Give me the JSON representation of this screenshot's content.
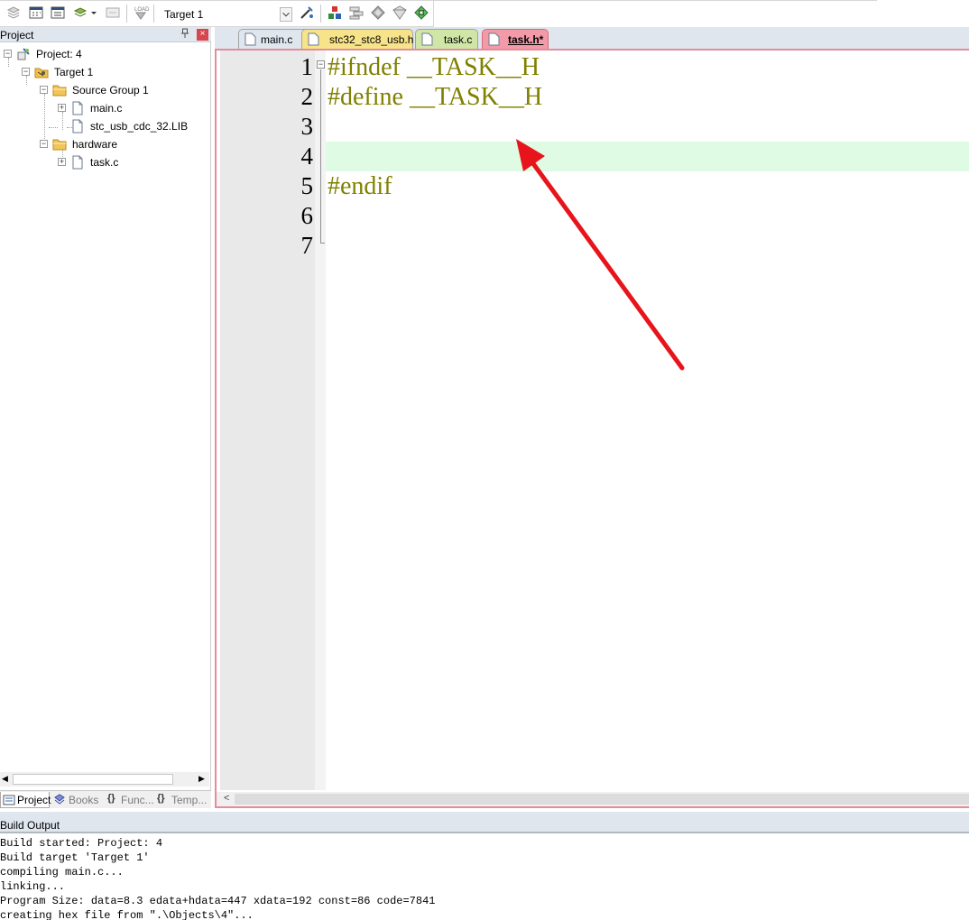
{
  "toolbar": {
    "target_value": "Target 1",
    "buttons": [
      "translate-icon",
      "build-icon",
      "rebuild-icon",
      "batch-build-icon",
      "stop-build-icon",
      "download-icon",
      "target-options-icon",
      "file-extensions-icon",
      "manage-components-icon",
      "select-packs-icon",
      "manage-run-time-icon",
      "pack-installer-icon"
    ]
  },
  "project_panel": {
    "title": "Project",
    "pin": "ȡ",
    "close": "×",
    "tree": {
      "project": "Project: 4",
      "target": "Target 1",
      "group1": "Source Group 1",
      "main_c": "main.c",
      "lib": "stc_usb_cdc_32.LIB",
      "group2": "hardware",
      "task_c": "task.c"
    },
    "tabs": [
      {
        "label": "Project",
        "icon": "project-tab-icon"
      },
      {
        "label": "Books",
        "icon": "books-icon"
      },
      {
        "label": "Func...",
        "icon": "functions-icon"
      },
      {
        "label": "Temp...",
        "icon": "templates-icon"
      }
    ]
  },
  "editor": {
    "tabs": [
      {
        "label": "main.c",
        "color": "#dfe6ee"
      },
      {
        "label": "stc32_stc8_usb.h",
        "color": "#f7e38a"
      },
      {
        "label": "task.c",
        "color": "#cfe6a6"
      },
      {
        "label": "task.h*",
        "color": "#f29aa8"
      }
    ],
    "line_numbers": [
      "1",
      "2",
      "3",
      "4",
      "5",
      "6",
      "7"
    ],
    "lines": [
      "#ifndef __TASK__H",
      "#define __TASK__H",
      "",
      "",
      "#endif",
      "",
      ""
    ],
    "current_line": 4,
    "scroll_left": "<"
  },
  "colors": {
    "keyword": "#808000",
    "current_line_bg": "#e0fbe3",
    "annotation_arrow": "#e8141c"
  },
  "build_output": {
    "title": "Build Output",
    "lines": [
      "Build started: Project: 4",
      "Build target 'Target 1'",
      "compiling main.c...",
      "linking...",
      "Program Size: data=8.3 edata+hdata=447 xdata=192 const=86 code=7841",
      "creating hex file from \".\\Objects\\4\"..."
    ]
  }
}
